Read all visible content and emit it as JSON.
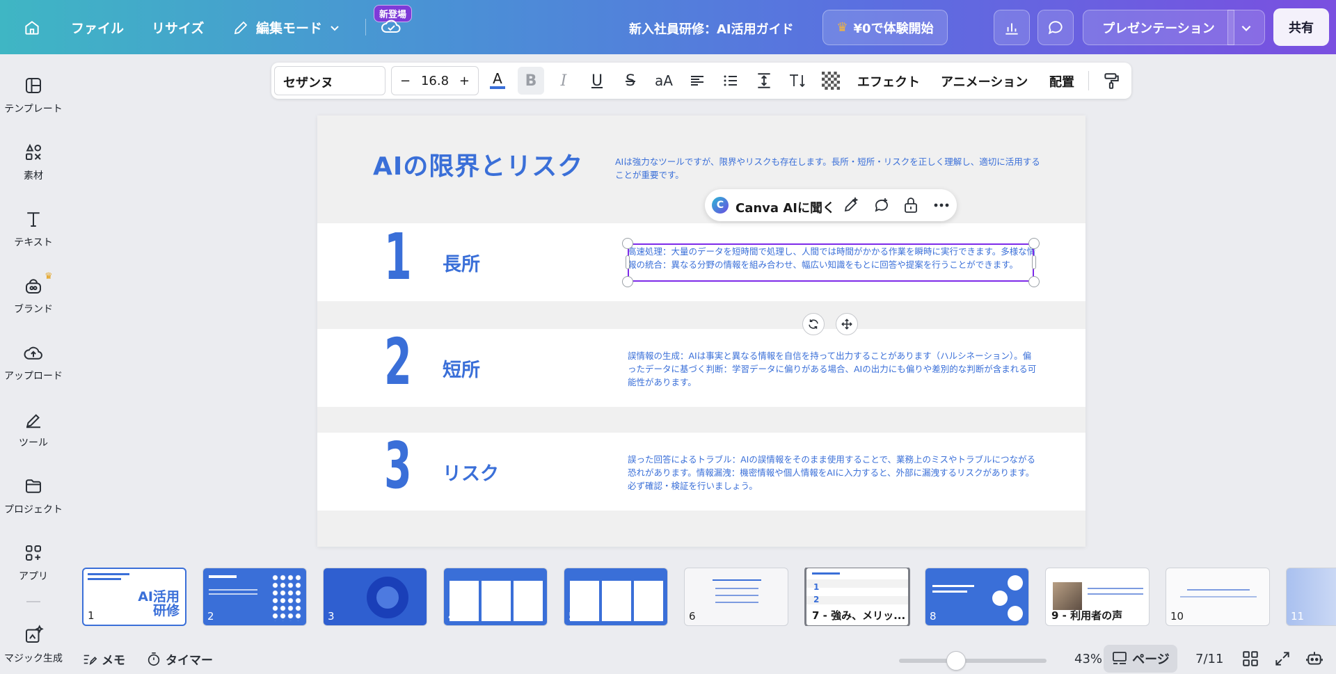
{
  "topbar": {
    "menu_file": "ファイル",
    "menu_resize": "リサイズ",
    "menu_edit_mode": "編集モード",
    "new_badge": "新登場",
    "doc_title": "新入社員研修：AI活用ガイド",
    "trial_label": "¥0で体験開始",
    "present_label": "プレゼンテーション",
    "share_label": "共有"
  },
  "sidebar": {
    "items": [
      {
        "label": "テンプレート",
        "icon": "template-icon"
      },
      {
        "label": "素材",
        "icon": "elements-icon"
      },
      {
        "label": "テキスト",
        "icon": "text-icon"
      },
      {
        "label": "ブランド",
        "icon": "brand-icon"
      },
      {
        "label": "アップロード",
        "icon": "upload-icon"
      },
      {
        "label": "ツール",
        "icon": "tools-icon"
      },
      {
        "label": "プロジェクト",
        "icon": "folder-icon"
      },
      {
        "label": "アプリ",
        "icon": "apps-icon"
      },
      {
        "label": "マジック生成",
        "icon": "magic-icon"
      }
    ]
  },
  "text_toolbar": {
    "font": "セザンヌ",
    "size_minus": "−",
    "size_value": "16.8",
    "size_plus": "+",
    "case_label": "aA",
    "effects": "エフェクト",
    "animation": "アニメーション",
    "arrange": "配置"
  },
  "slide": {
    "title": "AIの限界とリスク",
    "intro": "AIは強力なツールですが、限界やリスクも存在します。長所・短所・リスクを正しく理解し、適切に活用することが重要です。",
    "rows": [
      {
        "number": "1",
        "heading": "長所",
        "body": "高速処理：大量のデータを短時間で処理し、人間では時間がかかる作業を瞬時に実行できます。多様な情報の統合：異なる分野の情報を組み合わせ、幅広い知識をもとに回答や提案を行うことができます。"
      },
      {
        "number": "2",
        "heading": "短所",
        "body": "誤情報の生成：AIは事実と異なる情報を自信を持って出力することがあります（ハルシネーション）。偏ったデータに基づく判断：学習データに偏りがある場合、AIの出力にも偏りや差別的な判断が含まれる可能性があります。"
      },
      {
        "number": "3",
        "heading": "リスク",
        "body": "誤った回答によるトラブル：AIの誤情報をそのまま使用することで、業務上のミスやトラブルにつながる恐れがあります。情報漏洩：機密情報や個人情報をAIに入力すると、外部に漏洩するリスクがあります。必ず確認・検証を行いましょう。"
      }
    ]
  },
  "ai_bar": {
    "label": "Canva AIに聞く"
  },
  "thumbnails": [
    {
      "num": "1",
      "label": "",
      "title": "AI活用研修"
    },
    {
      "num": "2",
      "label": ""
    },
    {
      "num": "3",
      "label": ""
    },
    {
      "num": "4",
      "label": ""
    },
    {
      "num": "5",
      "label": ""
    },
    {
      "num": "6",
      "label": ""
    },
    {
      "num": "",
      "label": "7 - 強み、メリッ..."
    },
    {
      "num": "8",
      "label": ""
    },
    {
      "num": "",
      "label": "9 - 利用者の声"
    },
    {
      "num": "10",
      "label": ""
    },
    {
      "num": "11",
      "label": ""
    }
  ],
  "bottombar": {
    "memo": "メモ",
    "timer": "タイマー",
    "zoom_value": 43,
    "zoom": "43%",
    "page_label": "ページ",
    "page_count": "7/11"
  },
  "colors": {
    "accent_blue": "#3a6fd8",
    "selection_purple": "#7d2ae8"
  }
}
